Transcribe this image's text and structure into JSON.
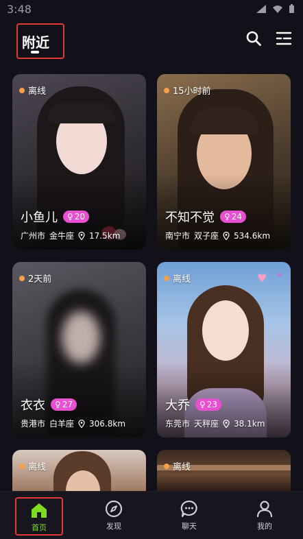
{
  "status_bar": {
    "time": "3:48"
  },
  "header": {
    "active_tab": "附近"
  },
  "cards": [
    {
      "status": "离线",
      "name": "小鱼儿",
      "age": "20",
      "city": "广州市",
      "zodiac": "金牛座",
      "distance": "17.5km"
    },
    {
      "status": "15小时前",
      "name": "不知不觉",
      "age": "24",
      "city": "南宁市",
      "zodiac": "双子座",
      "distance": "534.6km"
    },
    {
      "status": "2天前",
      "name": "衣衣",
      "age": "27",
      "city": "贵港市",
      "zodiac": "白羊座",
      "distance": "306.8km"
    },
    {
      "status": "离线",
      "name": "大乔",
      "age": "23",
      "city": "东莞市",
      "zodiac": "天秤座",
      "distance": "38.1km"
    },
    {
      "status": "离线"
    },
    {
      "status": "离线"
    }
  ],
  "bottom_nav": {
    "home": "首页",
    "discover": "发现",
    "chat": "聊天",
    "me": "我的"
  },
  "colors": {
    "accent_green": "#7ddc1f",
    "age_badge": "#e94fd1",
    "status_dot": "#f5a04a",
    "highlight_border": "#e53935"
  }
}
